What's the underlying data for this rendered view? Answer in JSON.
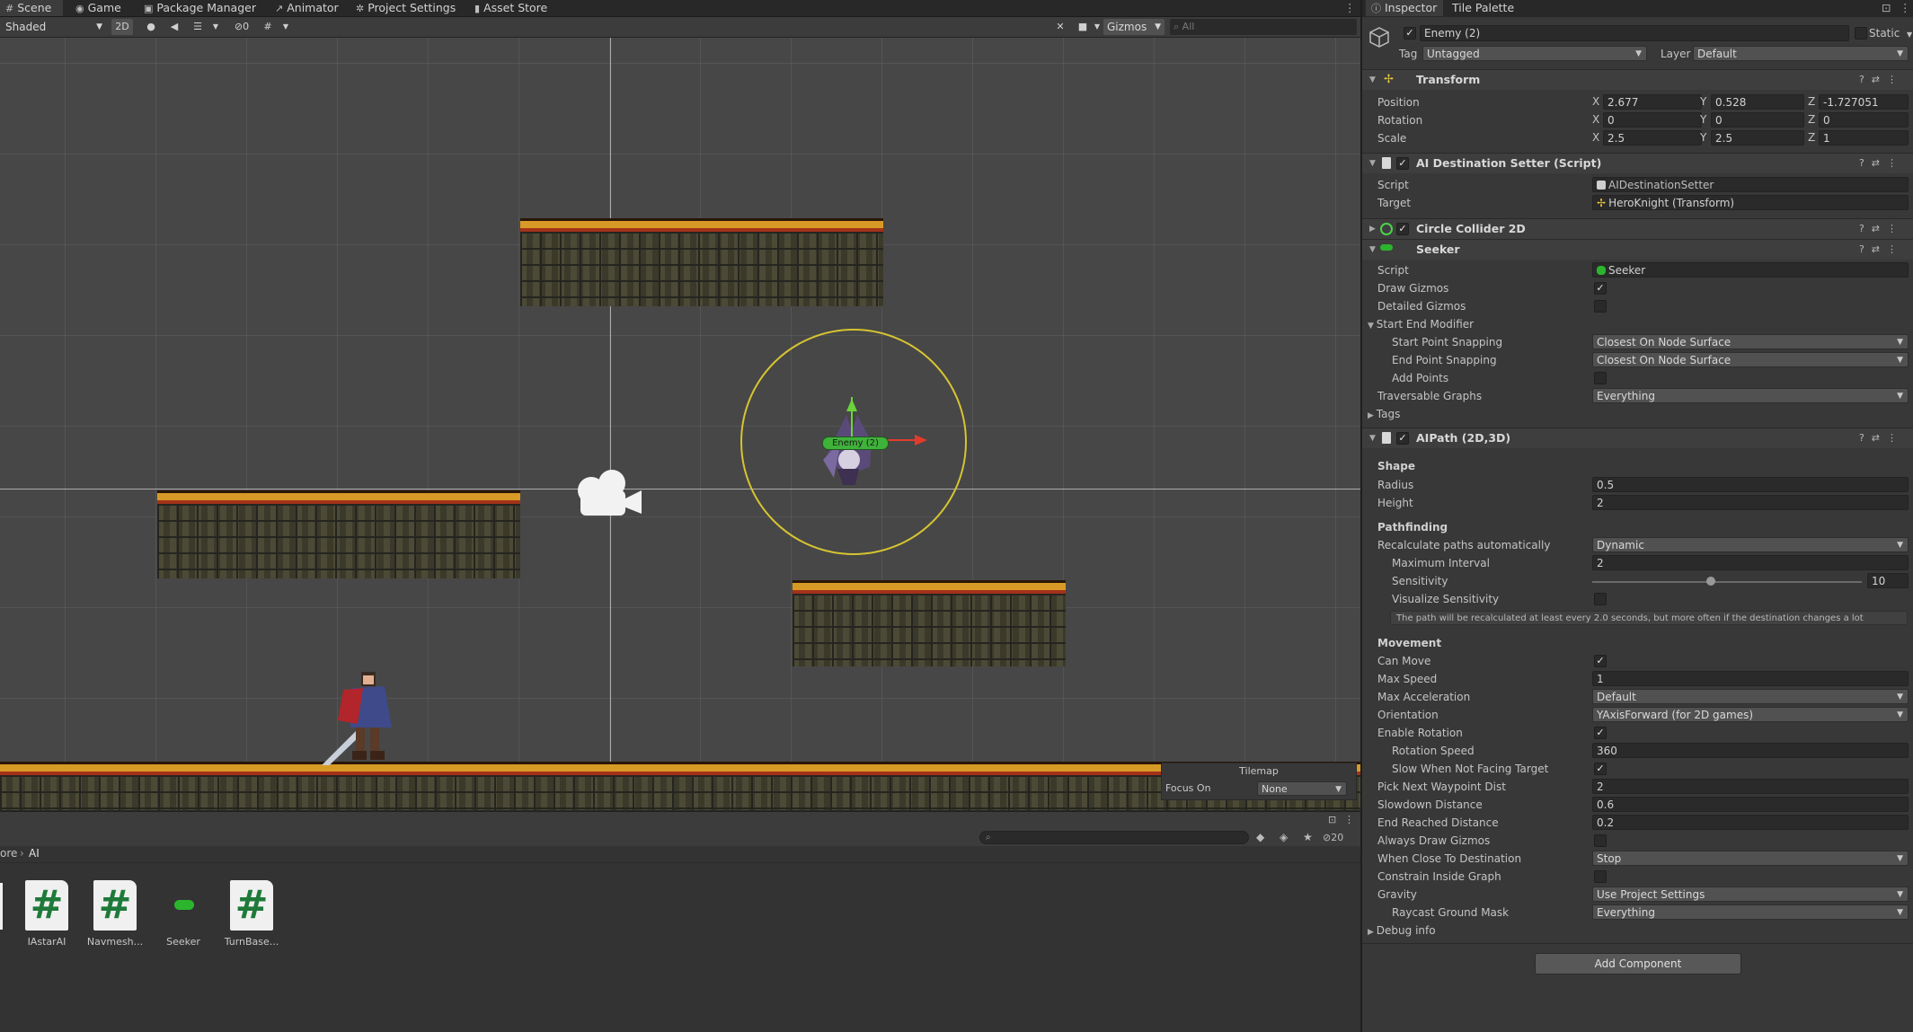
{
  "top_tabs": [
    {
      "label": "Scene",
      "icon": "hash-grid-icon"
    },
    {
      "label": "Game",
      "icon": "gamepad-icon"
    },
    {
      "label": "Package Manager",
      "icon": "package-icon"
    },
    {
      "label": "Animator",
      "icon": "animator-icon"
    },
    {
      "label": "Project Settings",
      "icon": "gear-icon"
    },
    {
      "label": "Asset Store",
      "icon": "shop-bag-icon"
    }
  ],
  "scene_toolbar": {
    "shading_mode": "Shaded",
    "mode_2d": "2D",
    "hidden_count": "0",
    "gizmos_label": "Gizmos",
    "search_placeholder": "All"
  },
  "scene": {
    "enemy_label": "Enemy (2)"
  },
  "tilemap_panel": {
    "title": "Tilemap",
    "focus_label": "Focus On",
    "focus_value": "None"
  },
  "project": {
    "breadcrumb_prefix": "ore",
    "breadcrumb_folder": "AI",
    "hidden_count": "20",
    "assets": [
      {
        "label": "IAstarAI",
        "kind": "script"
      },
      {
        "label": "Navmesh...",
        "kind": "script"
      },
      {
        "label": "Seeker",
        "kind": "seeker"
      },
      {
        "label": "TurnBase...",
        "kind": "script"
      }
    ]
  },
  "inspector": {
    "tabs": [
      "Inspector",
      "Tile Palette"
    ],
    "object_name": "Enemy (2)",
    "static_label": "Static",
    "tag_label": "Tag",
    "tag_value": "Untagged",
    "layer_label": "Layer",
    "layer_value": "Default",
    "transform": {
      "title": "Transform",
      "position": {
        "label": "Position",
        "x": "2.677",
        "y": "0.528",
        "z": "-1.727051"
      },
      "rotation": {
        "label": "Rotation",
        "x": "0",
        "y": "0",
        "z": "0"
      },
      "scale": {
        "label": "Scale",
        "x": "2.5",
        "y": "2.5",
        "z": "1"
      }
    },
    "ai_destination_setter": {
      "title": "AI Destination Setter (Script)",
      "script_label": "Script",
      "script_value": "AIDestinationSetter",
      "target_label": "Target",
      "target_value": "HeroKnight (Transform)"
    },
    "circle_collider": {
      "title": "Circle Collider 2D"
    },
    "seeker": {
      "title": "Seeker",
      "script_label": "Script",
      "script_value": "Seeker",
      "draw_gizmos_label": "Draw Gizmos",
      "detailed_gizmos_label": "Detailed Gizmos",
      "start_end_modifier_label": "Start End Modifier",
      "start_point_snapping_label": "Start Point Snapping",
      "start_point_snapping_value": "Closest On Node Surface",
      "end_point_snapping_label": "End Point Snapping",
      "end_point_snapping_value": "Closest On Node Surface",
      "add_points_label": "Add Points",
      "traversable_graphs_label": "Traversable Graphs",
      "traversable_graphs_value": "Everything",
      "tags_label": "Tags"
    },
    "aipath": {
      "title": "AIPath (2D,3D)",
      "shape_header": "Shape",
      "radius_label": "Radius",
      "radius_value": "0.5",
      "height_label": "Height",
      "height_value": "2",
      "pathfinding_header": "Pathfinding",
      "recalc_label": "Recalculate paths automatically",
      "recalc_value": "Dynamic",
      "max_interval_label": "Maximum Interval",
      "max_interval_value": "2",
      "sensitivity_label": "Sensitivity",
      "sensitivity_value": "10",
      "sensitivity_fraction": 0.44,
      "visualize_sensitivity_label": "Visualize Sensitivity",
      "help_text": "The path will be recalculated at least every 2.0 seconds, but more often if the destination changes a lot",
      "movement_header": "Movement",
      "can_move_label": "Can Move",
      "max_speed_label": "Max Speed",
      "max_speed_value": "1",
      "max_accel_label": "Max Acceleration",
      "max_accel_value": "Default",
      "orientation_label": "Orientation",
      "orientation_value": "YAxisForward (for 2D games)",
      "enable_rotation_label": "Enable Rotation",
      "rotation_speed_label": "Rotation Speed",
      "rotation_speed_value": "360",
      "slow_not_facing_label": "Slow When Not Facing Target",
      "pick_next_label": "Pick Next Waypoint Dist",
      "pick_next_value": "2",
      "slowdown_label": "Slowdown Distance",
      "slowdown_value": "0.6",
      "end_reached_label": "End Reached Distance",
      "end_reached_value": "0.2",
      "always_draw_gizmos_label": "Always Draw Gizmos",
      "when_close_label": "When Close To Destination",
      "when_close_value": "Stop",
      "constrain_label": "Constrain Inside Graph",
      "gravity_label": "Gravity",
      "gravity_value": "Use Project Settings",
      "raycast_label": "Raycast Ground Mask",
      "raycast_value": "Everything",
      "debug_info_label": "Debug info"
    },
    "add_component_label": "Add Component"
  }
}
